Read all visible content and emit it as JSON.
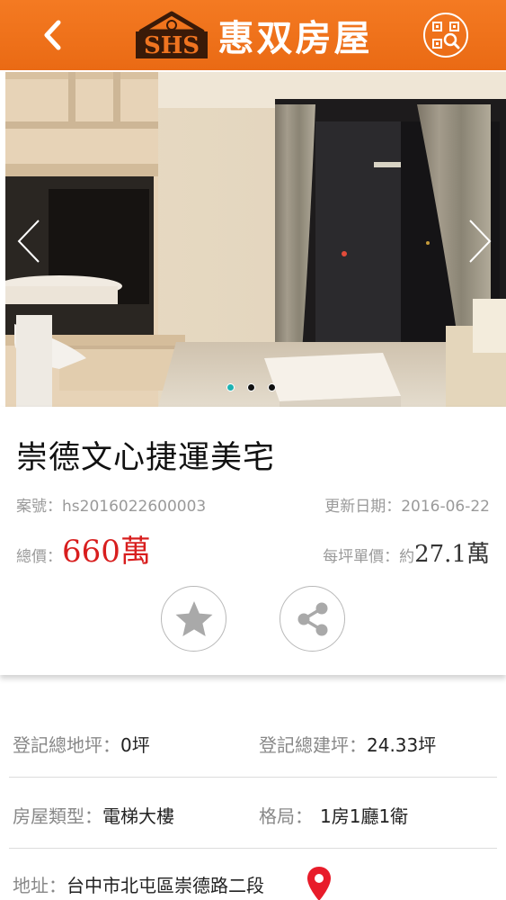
{
  "header": {
    "back_icon": "chevron-left-icon",
    "logo_letters": "SHS",
    "brand_name": "惠双房屋",
    "qr_icon": "qr-scan-icon"
  },
  "gallery": {
    "prev_icon": "chevron-left-icon",
    "next_icon": "chevron-right-icon",
    "dots": [
      true,
      false,
      false
    ]
  },
  "listing": {
    "title": "崇德文心捷運美宅",
    "case_label": "案號：",
    "case_no": "hs2016022600003",
    "updated_label": "更新日期：",
    "updated_date": "2016-06-22",
    "total_label": "總價：",
    "total_price": "660萬",
    "unit_label": "每坪單價：",
    "unit_prefix": "約",
    "unit_price": "27.1萬",
    "favorite_icon": "star-icon",
    "share_icon": "share-icon"
  },
  "details": {
    "land_label": "登記總地坪：",
    "land_value": "0坪",
    "building_label": "登記總建坪：",
    "building_value": "24.33坪",
    "type_label": "房屋類型：",
    "type_value": "電梯大樓",
    "layout_label": "格局：",
    "layout_value": "1房1廳1衛",
    "address_label": "地址：",
    "address_value": "台中市北屯區崇德路二段",
    "map_icon": "map-pin-icon"
  },
  "colors": {
    "brand_orange": "#f07420",
    "price_red": "#d81e1e",
    "dot_active": "#1db2b2",
    "pin_red": "#e81c2a"
  }
}
